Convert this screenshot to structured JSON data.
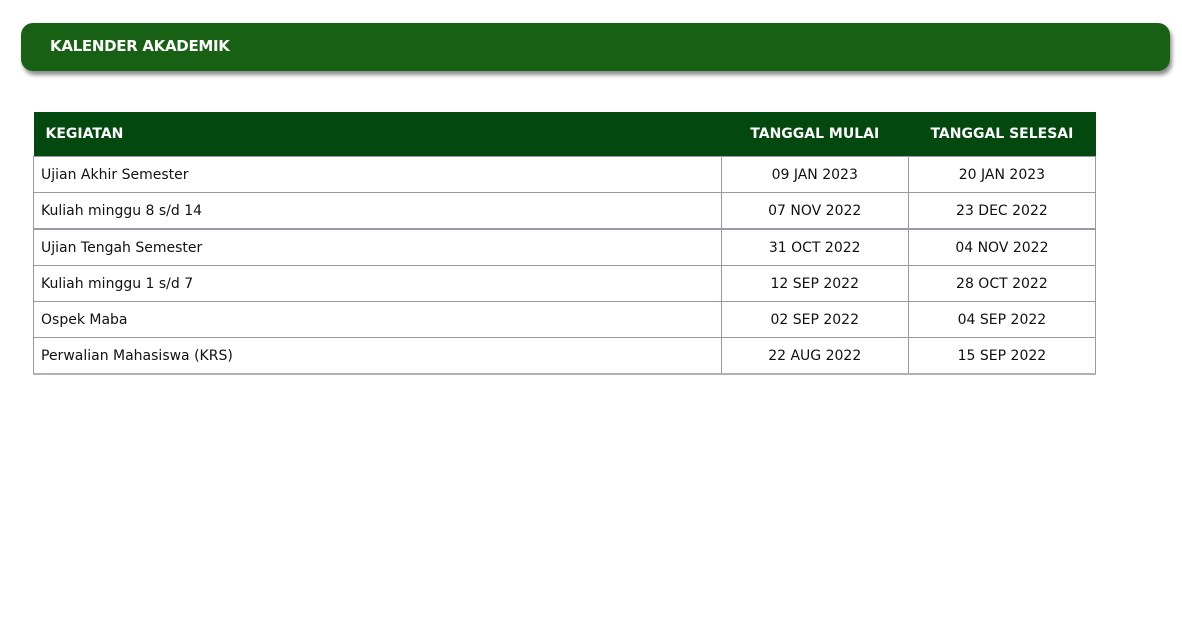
{
  "header": {
    "title": "KALENDER AKADEMIK"
  },
  "table": {
    "columns": [
      "KEGIATAN",
      "TANGGAL MULAI",
      "TANGGAL SELESAI"
    ],
    "rows": [
      {
        "kegiatan": "Ujian Akhir Semester",
        "mulai": "09 JAN 2023",
        "selesai": "20 JAN 2023"
      },
      {
        "kegiatan": "Kuliah minggu 8 s/d 14",
        "mulai": "07 NOV 2022",
        "selesai": "23 DEC 2022"
      },
      {
        "kegiatan": "Ujian Tengah Semester",
        "mulai": "31 OCT 2022",
        "selesai": "04 NOV 2022"
      },
      {
        "kegiatan": "Kuliah minggu 1 s/d 7",
        "mulai": "12 SEP 2022",
        "selesai": "28 OCT 2022"
      },
      {
        "kegiatan": "Ospek Maba",
        "mulai": "02 SEP 2022",
        "selesai": "04 SEP 2022"
      },
      {
        "kegiatan": "Perwalian Mahasiswa (KRS)",
        "mulai": "22 AUG 2022",
        "selesai": "15 SEP 2022"
      }
    ]
  },
  "colors": {
    "banner": "#186114",
    "table_header": "#03480f"
  }
}
